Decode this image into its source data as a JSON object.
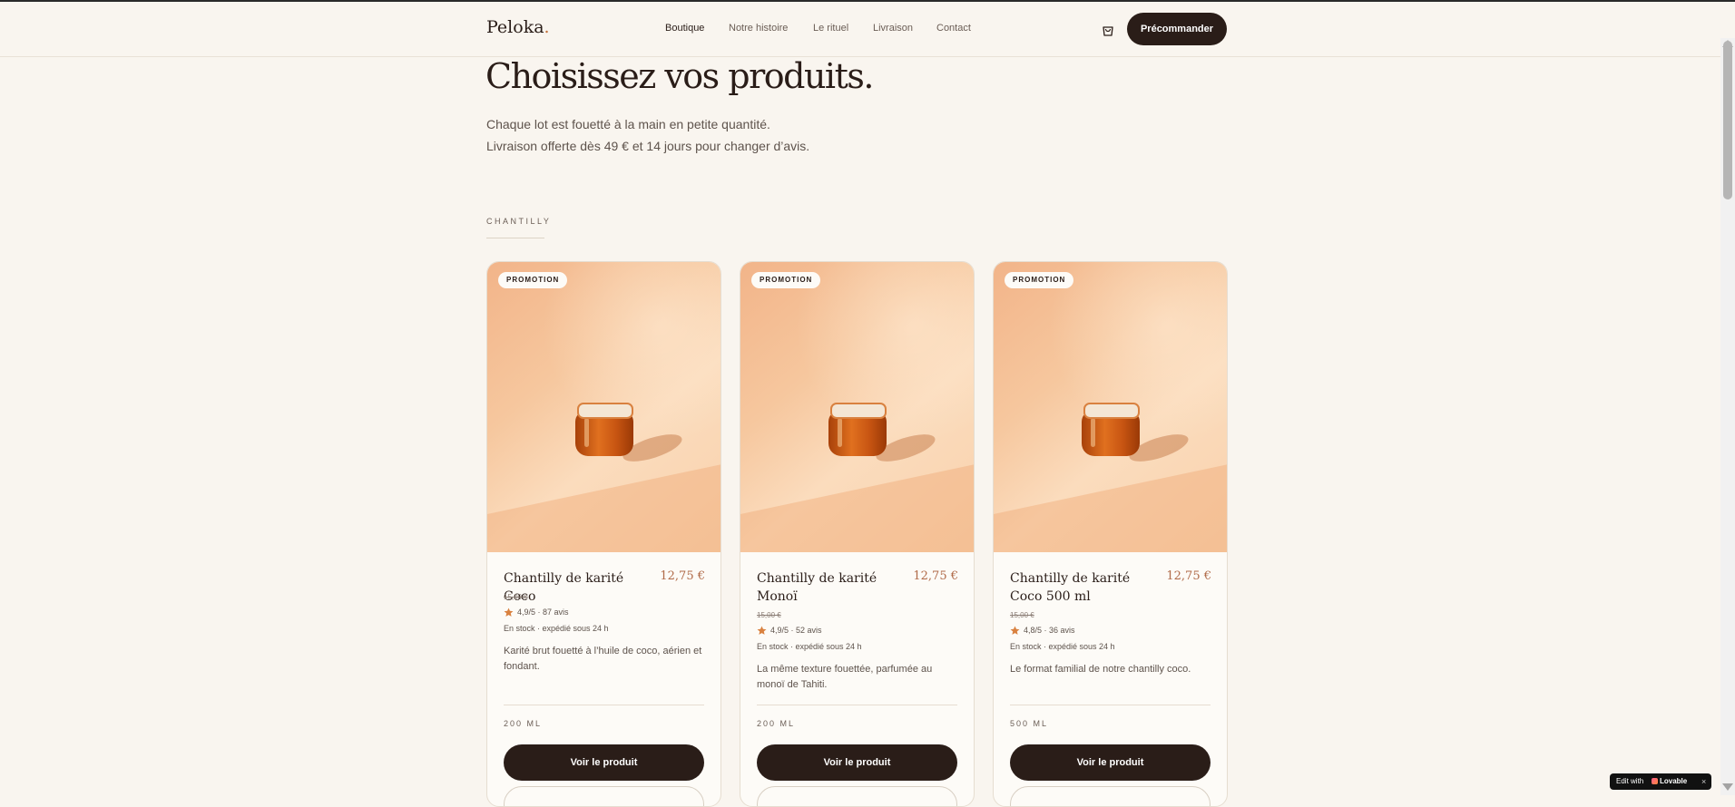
{
  "brand": {
    "name": "Peloka",
    "dot": "."
  },
  "nav": [
    "Boutique",
    "Notre histoire",
    "Le rituel",
    "Livraison",
    "Contact"
  ],
  "header": {
    "cta": "Précommander",
    "cart_icon": "shopping-bag-icon"
  },
  "hero": {
    "title": "Choisissez vos produits.",
    "line1": "Chaque lot est fouetté à la main en petite quantité.",
    "line2": "Livraison offerte dès 49 € et 14 jours pour changer d’avis."
  },
  "section": "CHANTILLY",
  "products": [
    {
      "badge": "PROMOTION",
      "name": "Chantilly de karité Coco",
      "price": "12,75 €",
      "old_price": "15,00 €",
      "rating": "4,9/5 · 87 avis",
      "stock": "En stock · expédié sous 24 h",
      "desc": "Karité brut fouetté à l’huile de coco, aérien et fondant.",
      "size": "200 ML",
      "cta": "Voir le produit"
    },
    {
      "badge": "PROMOTION",
      "name": "Chantilly de karité Monoï",
      "price": "12,75 €",
      "old_price": "15,00 €",
      "rating": "4,9/5 · 52 avis",
      "stock": "En stock · expédié sous 24 h",
      "desc": "La même texture fouettée, parfumée au monoï de Tahiti.",
      "size": "200 ML",
      "cta": "Voir le produit"
    },
    {
      "badge": "PROMOTION",
      "name": "Chantilly de karité Coco 500 ml",
      "price": "12,75 €",
      "old_price": "15,00 €",
      "rating": "4,8/5 · 36 avis",
      "stock": "En stock · expédié sous 24 h",
      "desc": "Le format familial de notre chantilly coco.",
      "size": "500 ML",
      "cta": "Voir le produit"
    }
  ],
  "lovable": {
    "edit_with": "Edit with",
    "brand": "Lovable",
    "close": "×"
  },
  "colors": {
    "background": "#f9f5ef",
    "primary": "#2a1d18",
    "price": "#b06a48",
    "star": "#d9813f"
  }
}
